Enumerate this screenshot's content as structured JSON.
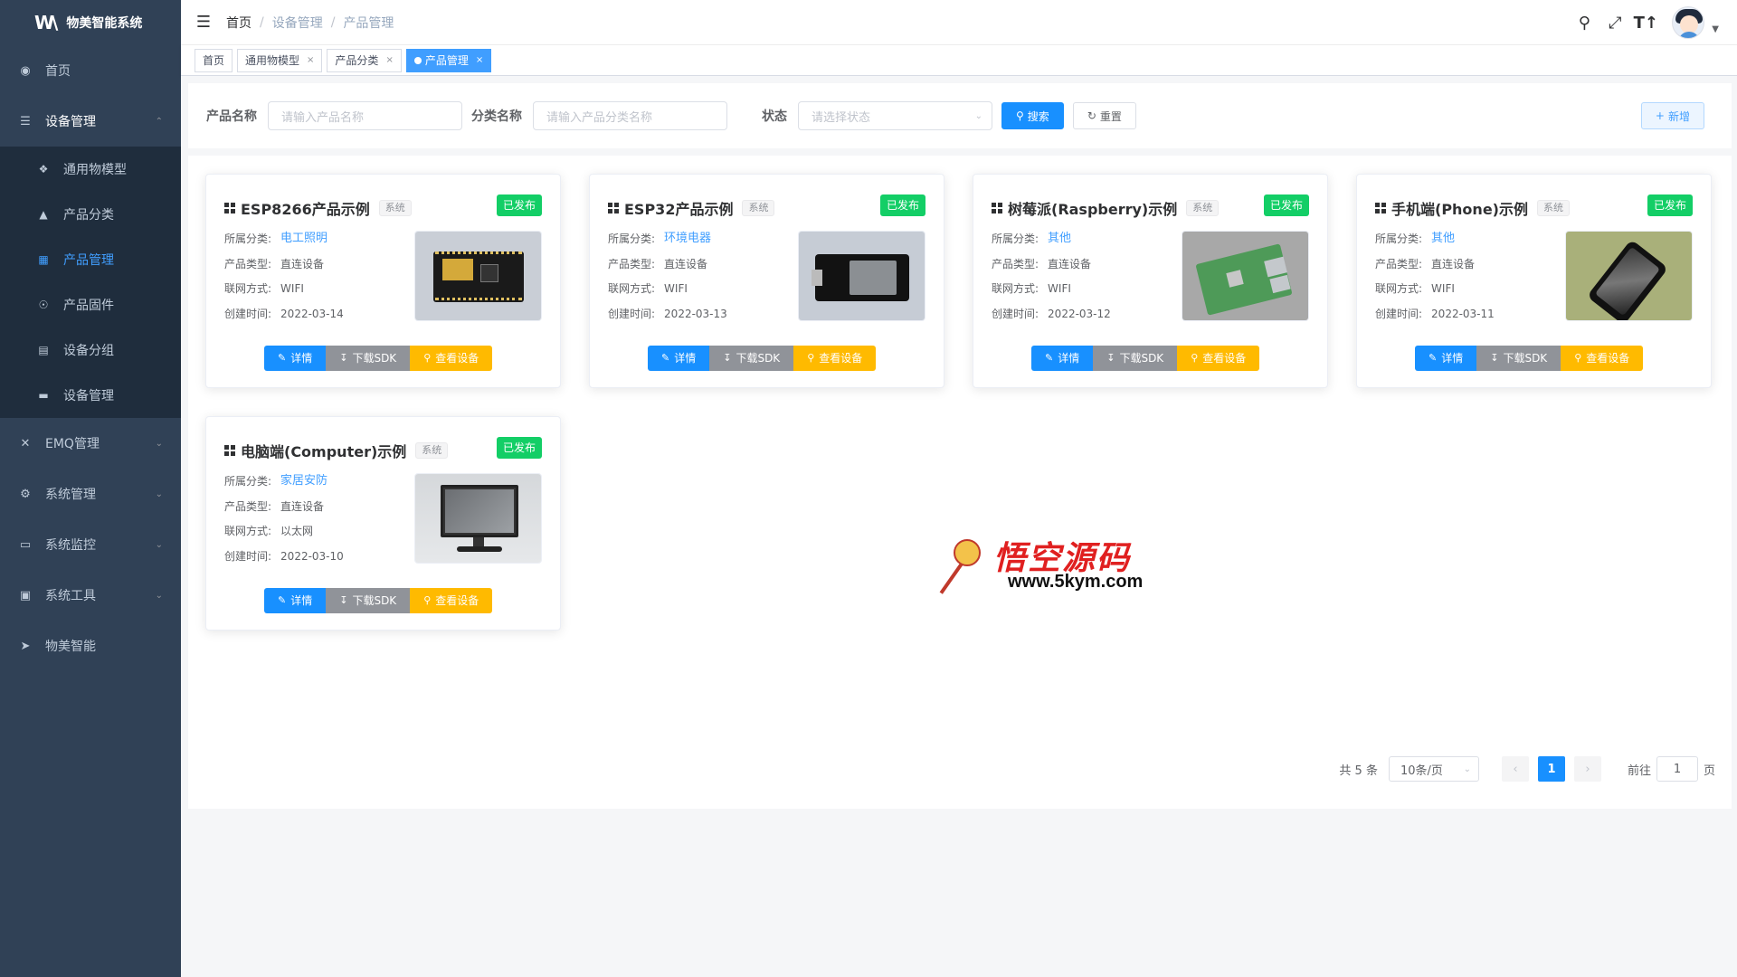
{
  "sidebar": {
    "brand_logo": "W\\",
    "brand_title": "物美智能系统",
    "items": [
      {
        "label": "首页",
        "icon": "dashboard-icon"
      },
      {
        "label": "设备管理",
        "icon": "layers-icon",
        "open": true,
        "children": [
          {
            "label": "通用物模型",
            "icon": "cube-icon"
          },
          {
            "label": "产品分类",
            "icon": "tree-icon"
          },
          {
            "label": "产品管理",
            "icon": "grid-icon",
            "active": true
          },
          {
            "label": "产品固件",
            "icon": "firmware-icon"
          },
          {
            "label": "设备分组",
            "icon": "group-icon"
          },
          {
            "label": "设备管理",
            "icon": "server-icon"
          }
        ]
      },
      {
        "label": "EMQ管理",
        "icon": "tools-icon"
      },
      {
        "label": "系统管理",
        "icon": "gear-icon"
      },
      {
        "label": "系统监控",
        "icon": "monitor-icon"
      },
      {
        "label": "系统工具",
        "icon": "toolbox-icon"
      },
      {
        "label": "物美智能",
        "icon": "send-icon"
      }
    ]
  },
  "navbar": {
    "breadcrumb": [
      "首页",
      "设备管理",
      "产品管理"
    ]
  },
  "tags": [
    {
      "label": "首页",
      "closable": false,
      "active": false
    },
    {
      "label": "通用物模型",
      "closable": true,
      "active": false
    },
    {
      "label": "产品分类",
      "closable": true,
      "active": false
    },
    {
      "label": "产品管理",
      "closable": true,
      "active": true
    }
  ],
  "search": {
    "product_name_label": "产品名称",
    "product_name_placeholder": "请输入产品名称",
    "category_label": "分类名称",
    "category_placeholder": "请输入产品分类名称",
    "status_label": "状态",
    "status_placeholder": "请选择状态",
    "search_button": "搜索",
    "reset_button": "重置",
    "add_button": "新增"
  },
  "card_labels": {
    "category": "所属分类:",
    "type": "产品类型:",
    "network": "联网方式:",
    "created": "创建时间:",
    "detail_button": "详情",
    "sdk_button": "下载SDK",
    "view_button": "查看设备"
  },
  "products": [
    {
      "name": "ESP8266产品示例",
      "tag": "系统",
      "status": "已发布",
      "category": "电工照明",
      "type": "直连设备",
      "network": "WIFI",
      "created": "2022-03-14",
      "image": "esp8266"
    },
    {
      "name": "ESP32产品示例",
      "tag": "系统",
      "status": "已发布",
      "category": "环境电器",
      "type": "直连设备",
      "network": "WIFI",
      "created": "2022-03-13",
      "image": "esp32"
    },
    {
      "name": "树莓派(Raspberry)示例",
      "tag": "系统",
      "status": "已发布",
      "category": "其他",
      "type": "直连设备",
      "network": "WIFI",
      "created": "2022-03-12",
      "image": "raspberry"
    },
    {
      "name": "手机端(Phone)示例",
      "tag": "系统",
      "status": "已发布",
      "category": "其他",
      "type": "直连设备",
      "network": "WIFI",
      "created": "2022-03-11",
      "image": "phone"
    },
    {
      "name": "电脑端(Computer)示例",
      "tag": "系统",
      "status": "已发布",
      "category": "家居安防",
      "type": "直连设备",
      "network": "以太网",
      "created": "2022-03-10",
      "image": "computer"
    }
  ],
  "pagination": {
    "total_text": "共 5 条",
    "page_size": "10条/页",
    "current_page": "1",
    "goto_label": "前往",
    "goto_value": "1",
    "page_suffix": "页"
  },
  "watermark": {
    "title": "悟空源码",
    "url": "www.5kym.com"
  },
  "colors": {
    "sidebar_bg": "#304156",
    "submenu_bg": "#1f2d3d",
    "primary": "#1890ff",
    "success": "#13ce66",
    "warning": "#ffba00",
    "info": "#909399"
  }
}
